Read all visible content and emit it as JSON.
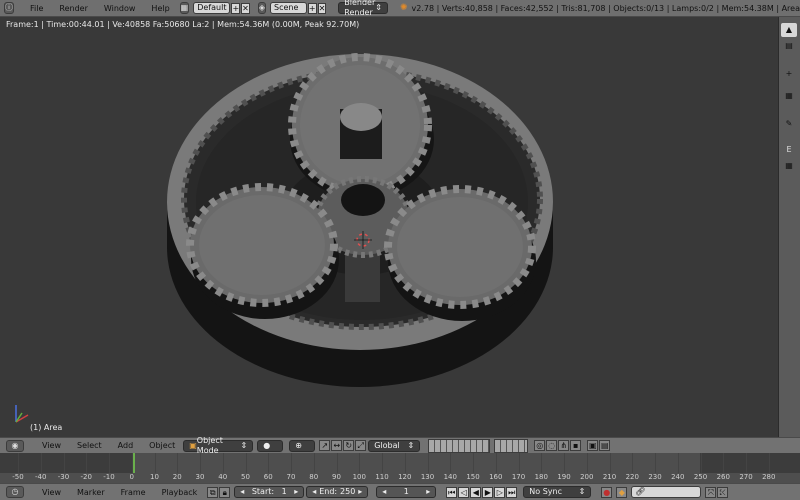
{
  "topbar": {
    "menus": [
      "File",
      "Render",
      "Window",
      "Help"
    ],
    "layout": "Default",
    "scene": "Scene",
    "engine": "Blender Render",
    "stats": "v2.78 | Verts:40,858 | Faces:42,552 | Tris:81,708 | Objects:0/13 | Lamps:0/2 | Mem:54.38M | Area"
  },
  "viewport": {
    "info": "Frame:1 | Time:00:44.01 | Ve:40858 Fa:50680 La:2 | Mem:54.36M (0.00M, Peak 92.70M)",
    "object_name": "(1) Area"
  },
  "right_panel": {
    "label": "E"
  },
  "view3d_header": {
    "menus": [
      "View",
      "Select",
      "Add",
      "Object"
    ],
    "mode": "Object Mode",
    "orientation": "Global"
  },
  "timeline": {
    "ticks": [
      "-50",
      "-40",
      "-30",
      "-20",
      "-10",
      "0",
      "10",
      "20",
      "30",
      "40",
      "50",
      "60",
      "70",
      "80",
      "90",
      "100",
      "110",
      "120",
      "130",
      "140",
      "150",
      "160",
      "170",
      "180",
      "190",
      "200",
      "210",
      "220",
      "230",
      "240",
      "250",
      "260",
      "270",
      "280"
    ],
    "current_frame_marker_color": "#6ab04c"
  },
  "timeline_header": {
    "menus": [
      "View",
      "Marker",
      "Frame",
      "Playback"
    ],
    "start_label": "Start:",
    "start_value": "1",
    "end_label": "End:",
    "end_value": "250",
    "current_frame": "1",
    "sync": "No Sync"
  },
  "colors": {
    "viewport_bg": "#393939",
    "header_bg": "#727272",
    "gear_face": "#6a6a6a",
    "gear_side": "#1a1a1a"
  }
}
